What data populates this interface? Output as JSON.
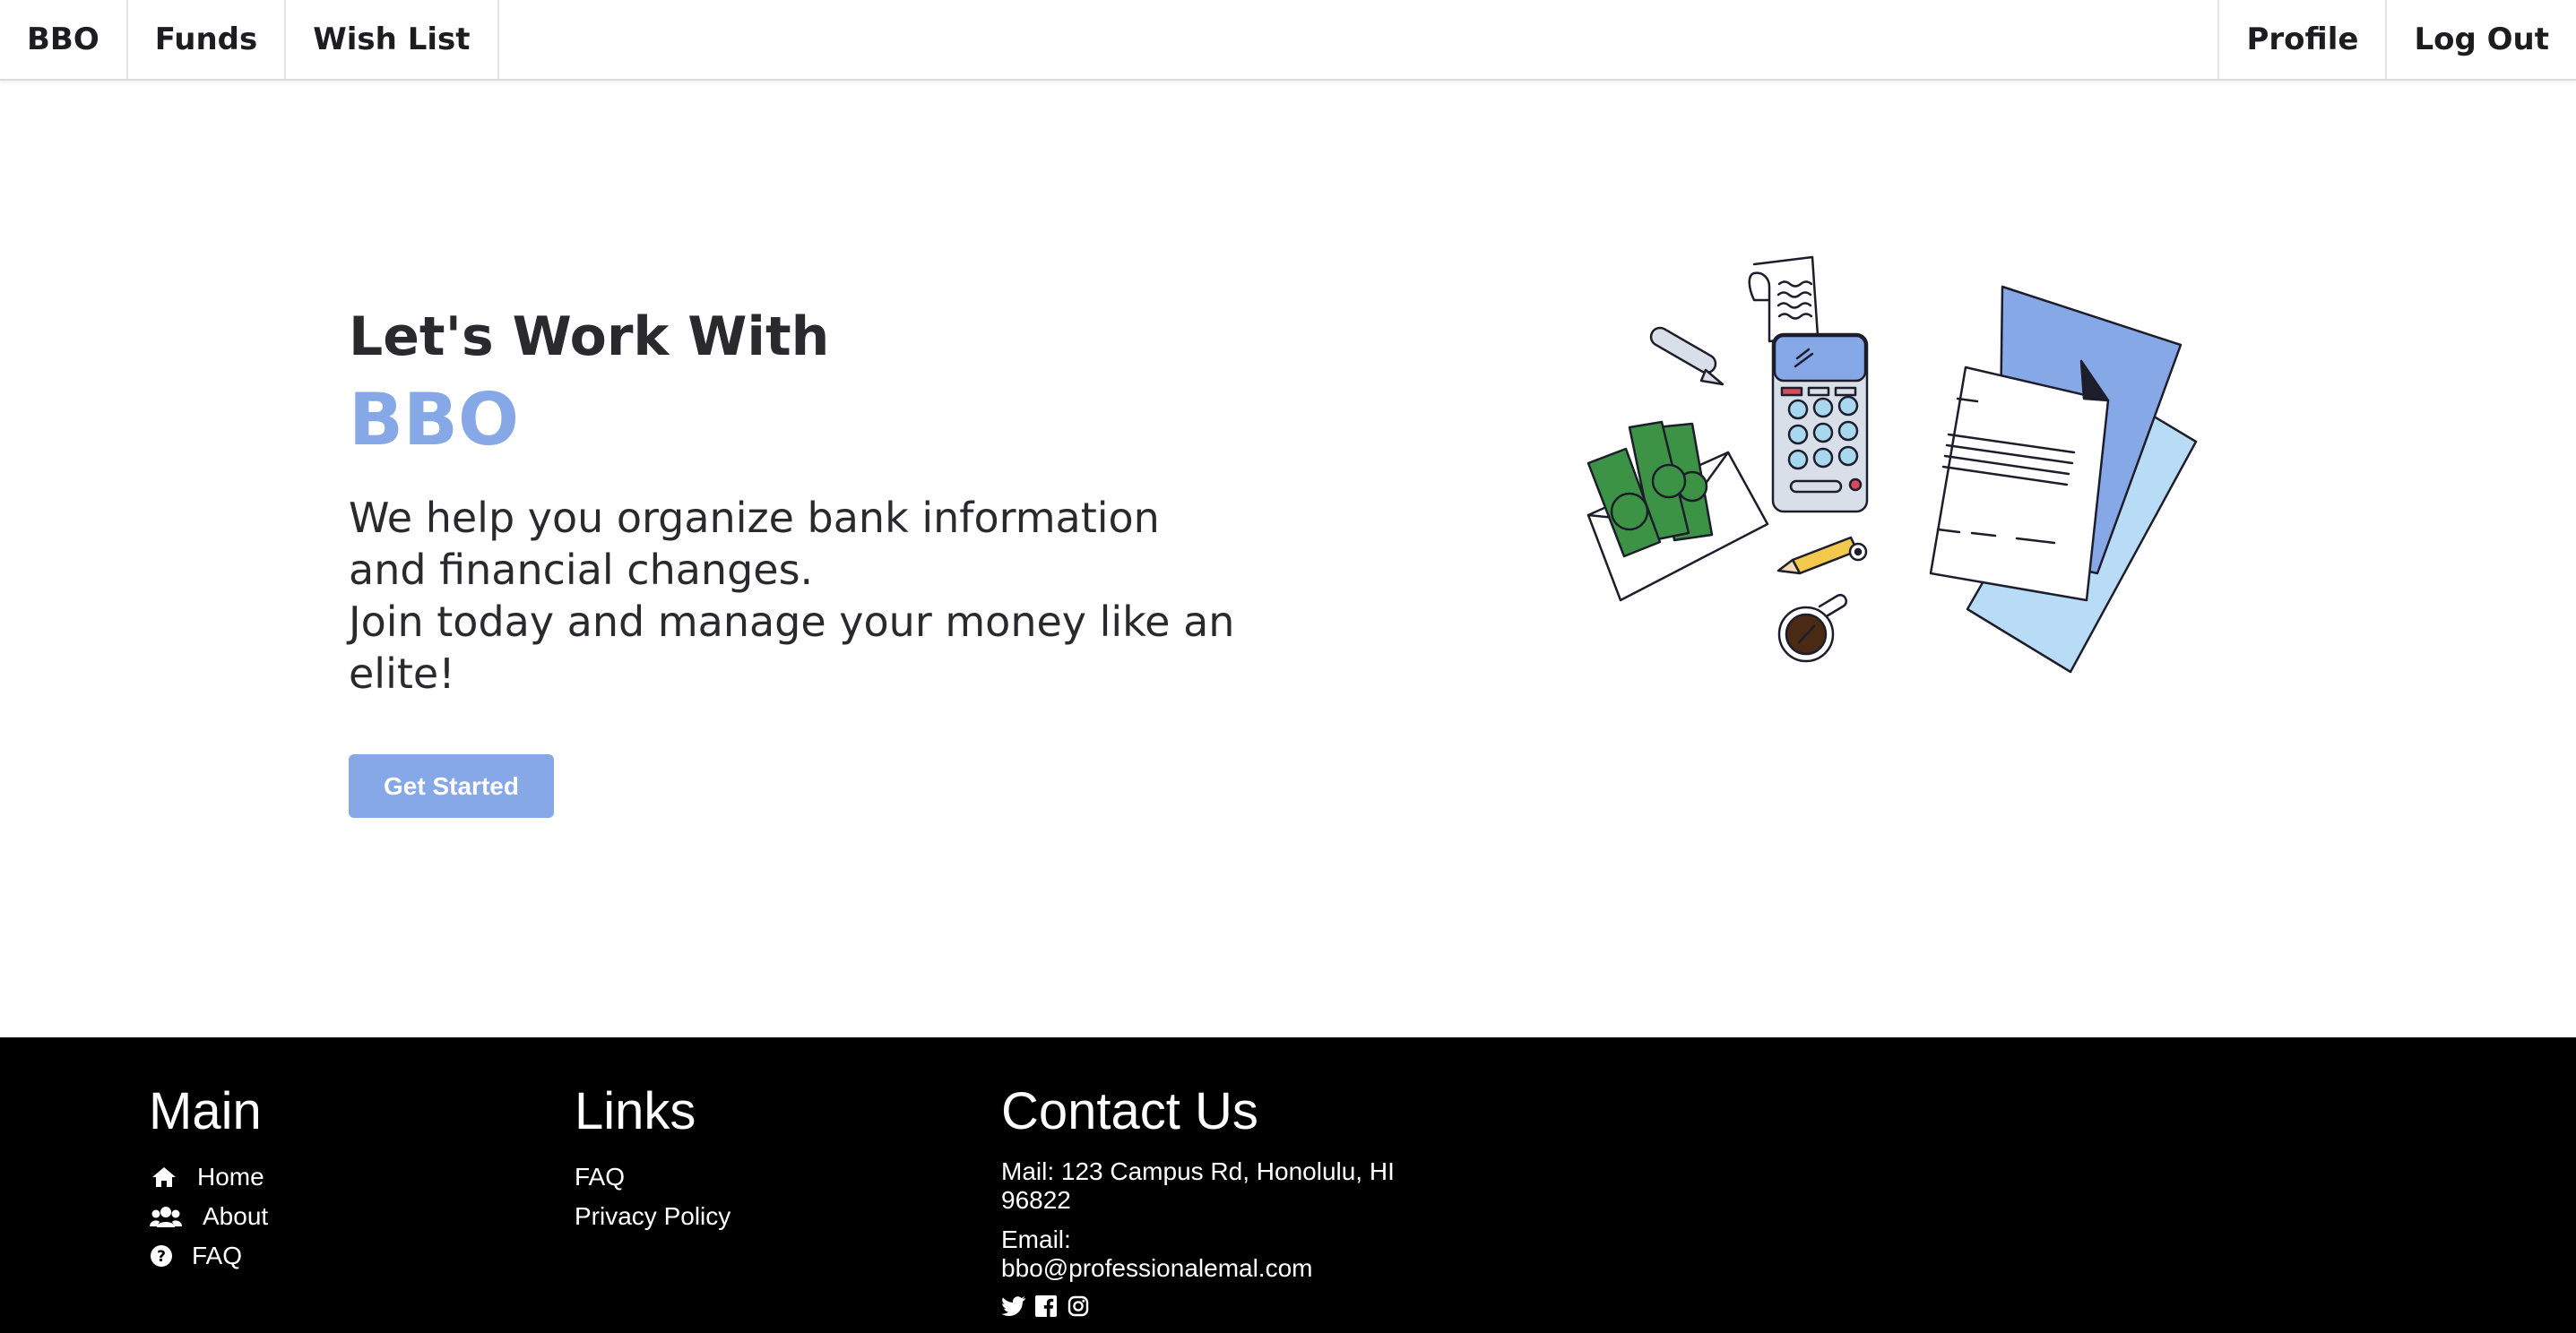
{
  "nav": {
    "brand": "BBO",
    "left_items": [
      "Funds",
      "Wish List"
    ],
    "right_items": [
      "Profile",
      "Log Out"
    ]
  },
  "hero": {
    "title": "Let's Work With",
    "brand": "BBO",
    "desc_line1": "We help you organize bank information and financial changes.",
    "desc_line2": "Join today and manage your money like an elite!",
    "cta_label": "Get Started",
    "accent_color": "#86a8e7"
  },
  "footer": {
    "main": {
      "heading": "Main",
      "items": [
        {
          "label": "Home",
          "icon": "home-icon"
        },
        {
          "label": "About",
          "icon": "users-icon"
        },
        {
          "label": "FAQ",
          "icon": "question-circle-icon"
        }
      ]
    },
    "links": {
      "heading": "Links",
      "items": [
        "FAQ",
        "Privacy Policy"
      ]
    },
    "contact": {
      "heading": "Contact Us",
      "mail": "Mail: 123 Campus Rd, Honolulu, HI 96822",
      "email_label": "Email:",
      "email": "bbo@professionalemal.com",
      "social_icons": [
        "twitter-icon",
        "facebook-icon",
        "instagram-icon"
      ]
    }
  }
}
